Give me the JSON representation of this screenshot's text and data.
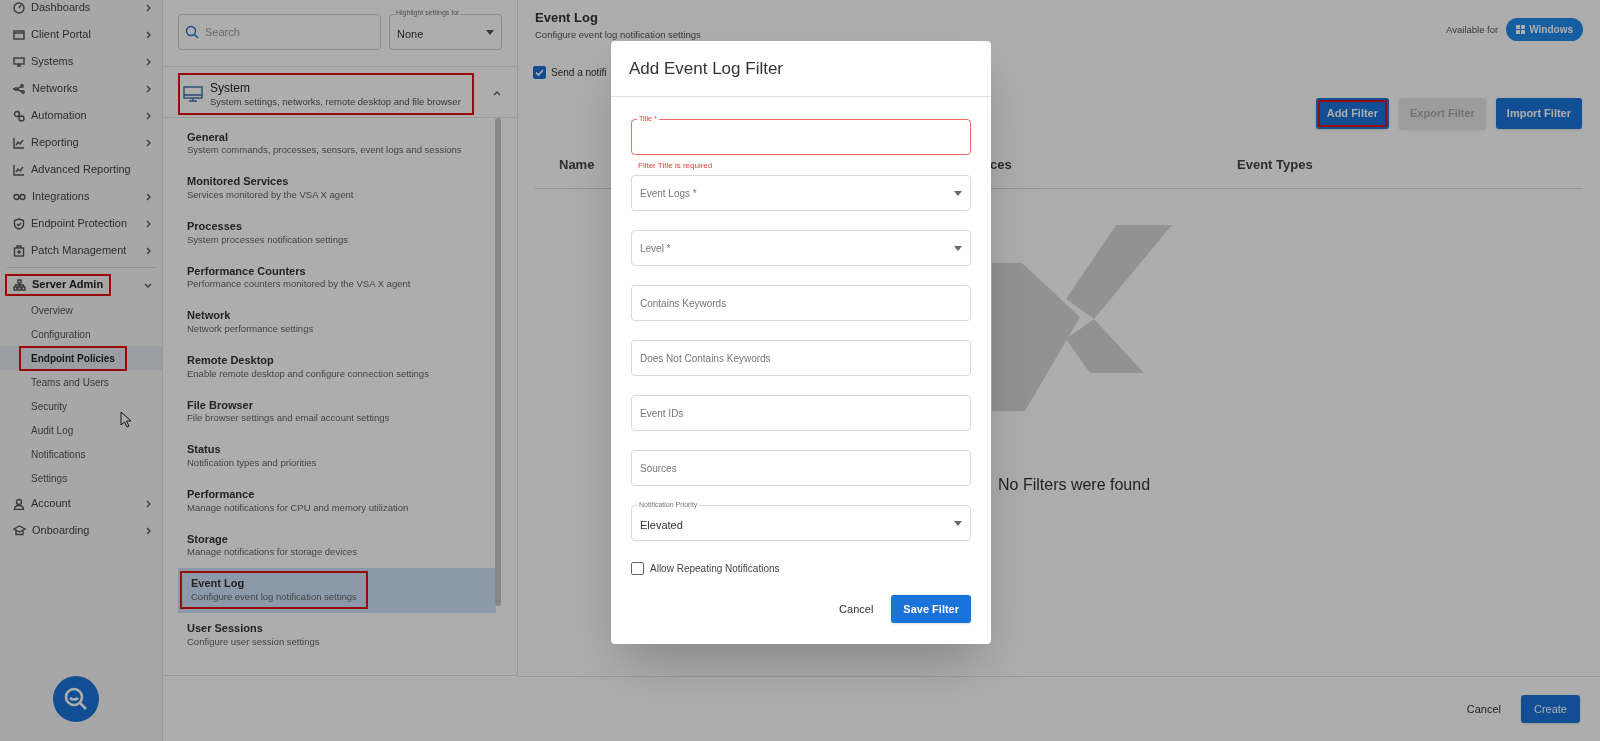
{
  "sidebar": {
    "groups": [
      [
        {
          "label": "Dashboards",
          "expanded": false
        },
        {
          "label": "Client Portal",
          "expanded": false
        },
        {
          "label": "Systems",
          "expanded": false
        },
        {
          "label": "Networks",
          "expanded": false
        },
        {
          "label": "Automation",
          "expanded": false
        },
        {
          "label": "Reporting",
          "expanded": false
        },
        {
          "label": "Advanced Reporting"
        },
        {
          "label": "Integrations",
          "expanded": false
        },
        {
          "label": "Endpoint Protection",
          "expanded": false
        },
        {
          "label": "Patch Management",
          "expanded": false
        }
      ],
      [
        {
          "label": "Server Admin",
          "expanded": true,
          "highlighted": true,
          "children": [
            {
              "label": "Overview",
              "selected": false,
              "highlighted": false
            },
            {
              "label": "Configuration",
              "selected": false,
              "highlighted": false
            },
            {
              "label": "Endpoint Policies",
              "selected": true,
              "highlighted": true
            },
            {
              "label": "Teams and Users",
              "selected": false,
              "highlighted": false
            },
            {
              "label": "Security",
              "selected": false,
              "highlighted": false
            },
            {
              "label": "Audit Log",
              "selected": false,
              "highlighted": false
            },
            {
              "label": "Notifications",
              "selected": false,
              "highlighted": false
            },
            {
              "label": "Settings",
              "selected": false,
              "highlighted": false
            }
          ]
        },
        {
          "label": "Account",
          "expanded": false
        },
        {
          "label": "Onboarding",
          "expanded": false
        }
      ]
    ]
  },
  "settings_panel": {
    "search": {
      "placeholder": "Search"
    },
    "highlight_select": {
      "label": "Highlight settings for",
      "value": "None"
    },
    "group": {
      "title": "System",
      "description": "System settings, networks, remote desktop and file browser",
      "expanded": true,
      "highlighted": true
    },
    "items": [
      {
        "title": "General",
        "description": "System commands, processes, sensors, event logs and sessions",
        "selected": false,
        "highlighted": false
      },
      {
        "title": "Monitored Services",
        "description": "Services monitored by the VSA X agent",
        "selected": false,
        "highlighted": false
      },
      {
        "title": "Processes",
        "description": "System processes notification settings",
        "selected": false,
        "highlighted": false
      },
      {
        "title": "Performance Counters",
        "description": "Performance counters monitored by the VSA X agent",
        "selected": false,
        "highlighted": false
      },
      {
        "title": "Network",
        "description": "Network performance settings",
        "selected": false,
        "highlighted": false
      },
      {
        "title": "Remote Desktop",
        "description": "Enable remote desktop and configure connection settings",
        "selected": false,
        "highlighted": false
      },
      {
        "title": "File Browser",
        "description": "File browser settings and email account settings",
        "selected": false,
        "highlighted": false
      },
      {
        "title": "Status",
        "description": "Notification types and priorities",
        "selected": false,
        "highlighted": false
      },
      {
        "title": "Performance",
        "description": "Manage notifications for CPU and memory utilization",
        "selected": false,
        "highlighted": false
      },
      {
        "title": "Storage",
        "description": "Manage notifications for storage devices",
        "selected": false,
        "highlighted": false
      },
      {
        "title": "Event Log",
        "description": "Configure event log notification settings",
        "selected": true,
        "highlighted": true
      },
      {
        "title": "User Sessions",
        "description": "Configure user session settings",
        "selected": false,
        "highlighted": false
      }
    ]
  },
  "content": {
    "title": "Event Log",
    "subtitle": "Configure event log notification settings",
    "available_label": "Available for",
    "platform": "Windows",
    "notify": {
      "label": "Send a notifi",
      "checked": true
    },
    "buttons": [
      {
        "label": "Add Filter",
        "disabled": false,
        "highlighted": true
      },
      {
        "label": "Export Filter",
        "disabled": true,
        "highlighted": false
      },
      {
        "label": "Import Filter",
        "disabled": false,
        "highlighted": false
      }
    ],
    "columns": [
      "Name",
      "ces",
      "Event Types"
    ],
    "empty_message": "No Filters were found",
    "footer": {
      "cancel": "Cancel",
      "create": "Create"
    }
  },
  "dialog": {
    "title": "Add Event Log Filter",
    "fields": [
      {
        "kind": "text",
        "label": "Title *",
        "error": "Filter Title is required"
      },
      {
        "kind": "select",
        "placeholder": "Event Logs *"
      },
      {
        "kind": "select",
        "placeholder": "Level *"
      },
      {
        "kind": "text",
        "placeholder": "Contains Keywords"
      },
      {
        "kind": "text",
        "placeholder": "Does Not Contains Keywords"
      },
      {
        "kind": "text",
        "placeholder": "Event IDs"
      },
      {
        "kind": "text",
        "placeholder": "Sources"
      },
      {
        "kind": "select",
        "label": "Notification Priority",
        "value": "Elevated"
      }
    ],
    "repeat": {
      "label": "Allow Repeating Notifications",
      "checked": false
    },
    "cancel": "Cancel",
    "save": "Save Filter"
  }
}
